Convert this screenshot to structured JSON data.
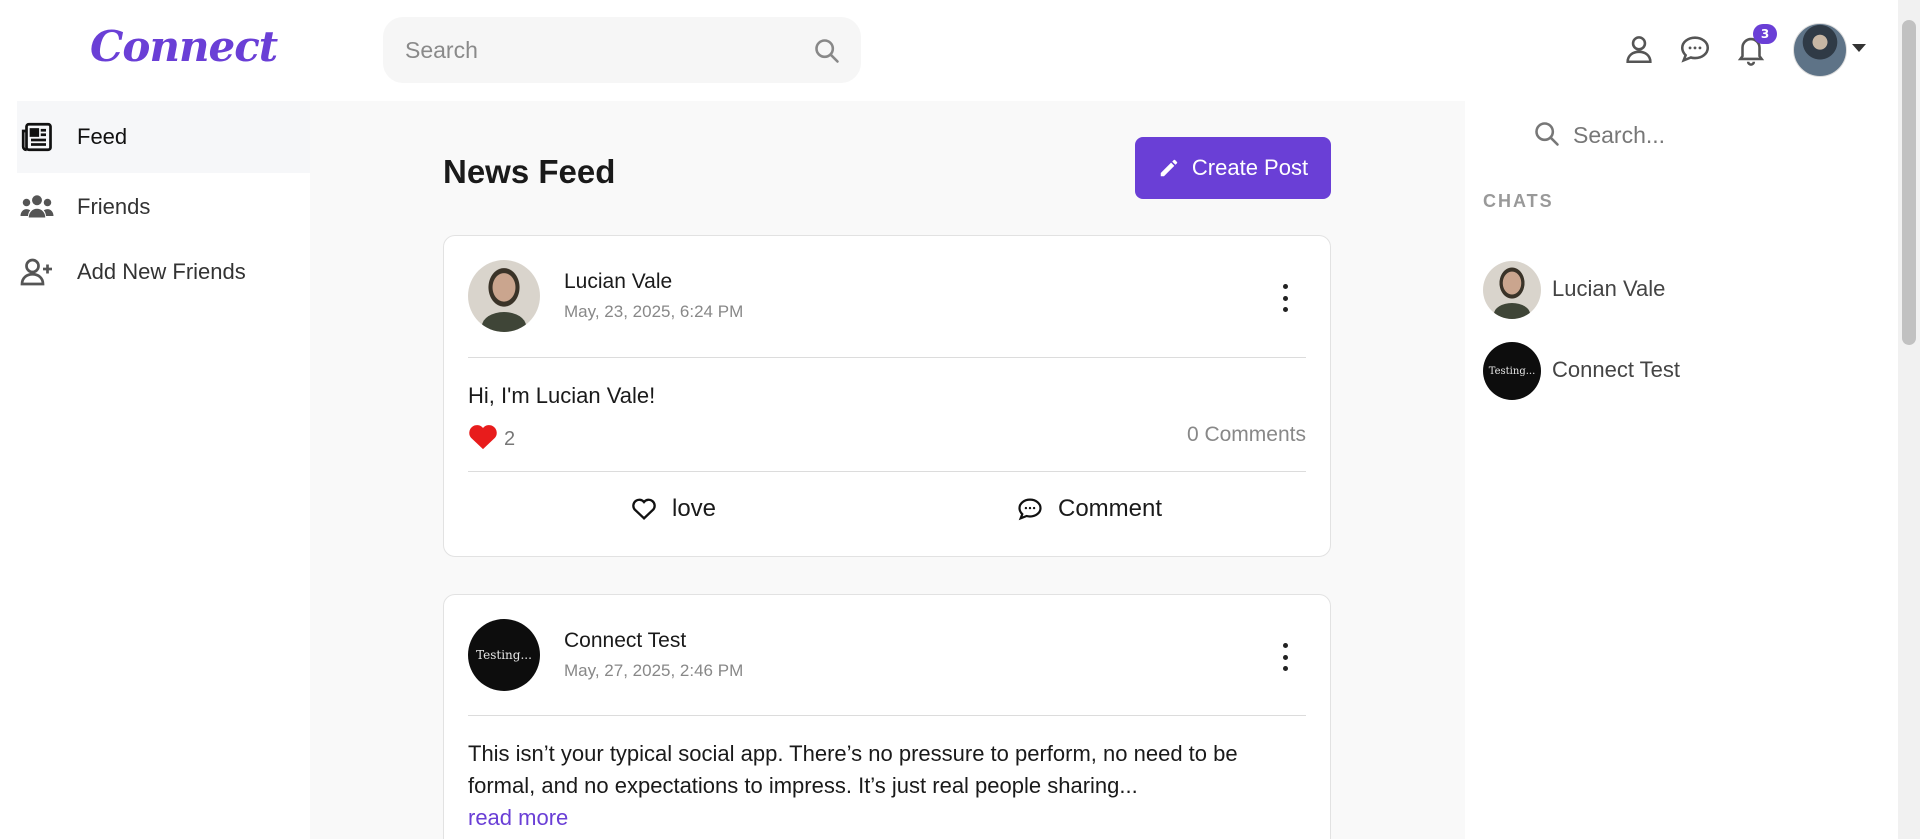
{
  "app": {
    "logo": "Connect"
  },
  "header": {
    "search_placeholder": "Search",
    "notification_count": "3",
    "icons": [
      "profile-icon",
      "messages-icon",
      "notifications-icon",
      "user-avatar"
    ]
  },
  "sidebar": {
    "items": [
      {
        "label": "Feed",
        "icon": "newspaper-icon",
        "active": true
      },
      {
        "label": "Friends",
        "icon": "users-icon",
        "active": false
      },
      {
        "label": "Add New Friends",
        "icon": "user-plus-icon",
        "active": false
      }
    ]
  },
  "feed": {
    "title": "News Feed",
    "create_label": "Create Post",
    "posts": [
      {
        "author": "Lucian Vale",
        "date": "May, 23, 2025, 6:24 PM",
        "text": "Hi, I'm Lucian Vale!",
        "likes": "2",
        "comments": "0 Comments",
        "love_label": "love",
        "comment_label": "Comment"
      },
      {
        "author": "Connect Test",
        "avatar_text": "Testing...",
        "date": "May, 27, 2025, 2:46 PM",
        "text": "This isn’t your typical social app. There’s no pressure to perform, no need to be formal, and no expectations to impress. It’s just real people sharing...",
        "read_more": "read more"
      }
    ]
  },
  "chats": {
    "search_placeholder": "Search...",
    "label": "CHATS",
    "items": [
      {
        "name": "Lucian Vale"
      },
      {
        "name": "Connect Test",
        "avatar_text": "Testing..."
      }
    ]
  },
  "colors": {
    "accent": "#6a3fd6",
    "heart": "#e81c1c",
    "panel_bg": "#f9f9f9"
  }
}
